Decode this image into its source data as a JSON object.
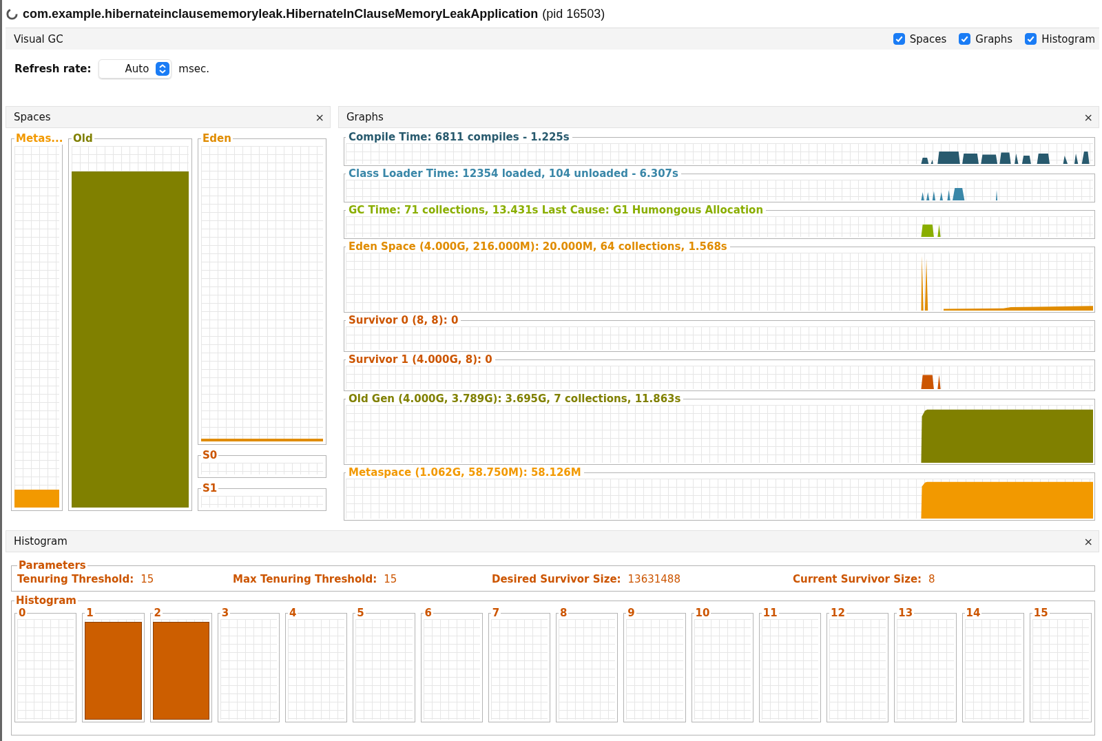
{
  "window": {
    "title": "com.example.hibernateinclausememoryleak.HibernateInClauseMemoryLeakApplication",
    "pid": "(pid 16503)"
  },
  "toolbar": {
    "title": "Visual GC",
    "toggles": [
      {
        "label": "Spaces",
        "checked": true
      },
      {
        "label": "Graphs",
        "checked": true
      },
      {
        "label": "Histogram",
        "checked": true
      }
    ]
  },
  "refresh": {
    "label": "Refresh rate:",
    "value": "Auto",
    "unit": "msec."
  },
  "spaces": {
    "title": "Spaces",
    "close": "×",
    "columns": [
      {
        "label": "Metas...",
        "color": "#f29900",
        "level": 0.05
      },
      {
        "label": "Old",
        "color": "#808000",
        "level": 0.93
      }
    ],
    "stack": [
      {
        "label": "Eden",
        "color": "#e08c00",
        "level": 0.01
      },
      {
        "label": "S0",
        "color": "#cc5500"
      },
      {
        "label": "S1",
        "color": "#cc5500"
      }
    ]
  },
  "graphs": {
    "title": "Graphs",
    "close": "×",
    "items": [
      {
        "title": "Compile Time: 6811 compiles - 1.225s",
        "color": "#285a6e",
        "kind": "bursts"
      },
      {
        "title": "Class Loader Time: 12354 loaded, 104 unloaded - 6.307s",
        "color": "#3a87a8",
        "kind": "ticks"
      },
      {
        "title": "GC Time: 71 collections, 13.431s  Last Cause: G1 Humongous Allocation",
        "color": "#8aae00",
        "kind": "pair"
      },
      {
        "title": "Eden Space (4.000G, 216.000M): 20.000M, 64 collections, 1.568s",
        "color": "#e08c00",
        "kind": "spikes"
      },
      {
        "title": "Survivor 0 (8, 8): 0",
        "color": "#cc5500",
        "kind": "empty"
      },
      {
        "title": "Survivor 1 (4.000G, 8): 0",
        "color": "#cc5500",
        "kind": "pair"
      },
      {
        "title": "Old Gen (4.000G, 3.789G): 3.695G, 7 collections, 11.863s",
        "color": "#808000",
        "kind": "block"
      },
      {
        "title": "Metaspace (1.062G, 58.750M): 58.126M",
        "color": "#f29900",
        "kind": "block"
      }
    ]
  },
  "histogram": {
    "title": "Histogram",
    "close": "×",
    "parameters_title": "Parameters",
    "parameters": [
      {
        "label": "Tenuring Threshold:",
        "value": "15"
      },
      {
        "label": "Max Tenuring Threshold:",
        "value": "15"
      },
      {
        "label": "Desired Survivor Size:",
        "value": "13631488"
      },
      {
        "label": "Current Survivor Size:",
        "value": "8"
      }
    ],
    "bins_title": "Histogram",
    "bins": [
      {
        "label": "0",
        "level": 0
      },
      {
        "label": "1",
        "level": 0.97
      },
      {
        "label": "2",
        "level": 0.97
      },
      {
        "label": "3",
        "level": 0
      },
      {
        "label": "4",
        "level": 0
      },
      {
        "label": "5",
        "level": 0
      },
      {
        "label": "6",
        "level": 0
      },
      {
        "label": "7",
        "level": 0
      },
      {
        "label": "8",
        "level": 0
      },
      {
        "label": "9",
        "level": 0
      },
      {
        "label": "10",
        "level": 0
      },
      {
        "label": "11",
        "level": 0
      },
      {
        "label": "12",
        "level": 0
      },
      {
        "label": "13",
        "level": 0
      },
      {
        "label": "14",
        "level": 0
      },
      {
        "label": "15",
        "level": 0
      }
    ]
  }
}
